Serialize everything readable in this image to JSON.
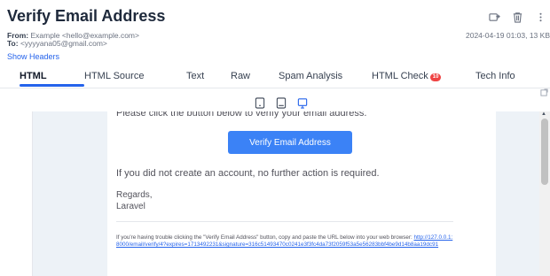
{
  "email": {
    "subject": "Verify Email Address",
    "from_label": "From:",
    "from_value": "Example <hello@example.com>",
    "to_label": "To:",
    "to_value": "<yyyyana05@gmail.com>",
    "date": "2024-04-19 01:03, 13 KB",
    "show_headers": "Show Headers"
  },
  "header_icons": [
    "forward-icon",
    "trash-icon",
    "more-icon"
  ],
  "tabs": [
    {
      "label": "HTML",
      "active": true
    },
    {
      "label": "HTML Source"
    },
    {
      "label": "Text"
    },
    {
      "label": "Raw"
    },
    {
      "label": "Spam Analysis"
    },
    {
      "label": "HTML Check",
      "badge": "10"
    },
    {
      "label": "Tech Info"
    }
  ],
  "device_icons": [
    "mobile-icon",
    "tablet-icon",
    "desktop-icon"
  ],
  "active_device": "desktop",
  "preview": {
    "partial_line": "Please click the button below to verify your email address.",
    "button_label": "Verify Email Address",
    "body_line": "If you did not create an account, no further action is required.",
    "regards": "Regards,",
    "signoff": "Laravel",
    "subcopy_text": "If you're having trouble clicking the \"Verify Email Address\" button, copy and paste the URL below into your web browser:",
    "subcopy_link": "http://127.0.0.1:8000/email/verify/4?expires=1713492231&signature=316c51493470c0241e3f3fc4da73f2059f53a5e56283bbf4be9d14b8aa19dc91"
  },
  "colors": {
    "accent": "#2563eb",
    "button": "#3b82f6",
    "badge": "#ef4444",
    "preview_bg": "#edf2f7"
  }
}
